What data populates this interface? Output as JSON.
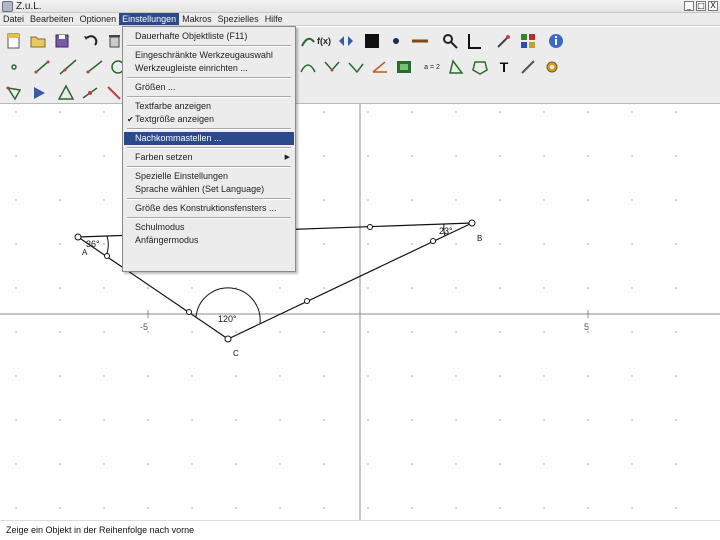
{
  "window": {
    "title": "Z.u.L.",
    "controls": [
      "_",
      "□",
      "X"
    ]
  },
  "menubar": [
    {
      "label": "Datei",
      "active": false
    },
    {
      "label": "Bearbeiten",
      "active": false
    },
    {
      "label": "Optionen",
      "active": false
    },
    {
      "label": "Einstellungen",
      "active": true
    },
    {
      "label": "Makros",
      "active": false
    },
    {
      "label": "Spezielles",
      "active": false
    },
    {
      "label": "Hilfe",
      "active": false
    }
  ],
  "toolbar": {
    "fx_label": "f(x)",
    "text_tool_label": "T",
    "ratio_label": "a = 2",
    "rows": [
      [
        "new-file-icon",
        "open-folder-icon",
        "save-disk-icon",
        "undo-icon",
        "delete-icon"
      ],
      [
        "point-icon",
        "segment-icon",
        "line-icon",
        "ray-icon",
        "circle-icon"
      ],
      [
        "polygon-icon",
        "triangle-icon",
        "reflect-icon",
        "move-icon",
        "tool-icon"
      ]
    ]
  },
  "dropdown": {
    "items": [
      {
        "label": "Dauerhafte Objektliste (F11)",
        "checked": false,
        "submenu": false,
        "highlighted": false
      },
      {
        "sep": true
      },
      {
        "label": "Eingeschränkte Werkzeugauswahl",
        "checked": false,
        "submenu": false,
        "highlighted": false
      },
      {
        "label": "Werkzeugleiste einrichten ...",
        "checked": false,
        "submenu": false,
        "highlighted": false
      },
      {
        "sep": true
      },
      {
        "label": "Größen ...",
        "checked": false,
        "submenu": false,
        "highlighted": false
      },
      {
        "sep": true
      },
      {
        "label": "Textfarbe anzeigen",
        "checked": false,
        "submenu": false,
        "highlighted": false
      },
      {
        "label": "Textgröße anzeigen",
        "checked": true,
        "submenu": false,
        "highlighted": false
      },
      {
        "sep": true
      },
      {
        "label": "Nachkommastellen ...",
        "checked": false,
        "submenu": false,
        "highlighted": true
      },
      {
        "sep": true
      },
      {
        "label": "Farben setzen",
        "checked": false,
        "submenu": true,
        "highlighted": false
      },
      {
        "sep": true
      },
      {
        "label": "Spezielle Einstellungen",
        "checked": false,
        "submenu": false,
        "highlighted": false
      },
      {
        "label": "Sprache wählen (Set Language)",
        "checked": false,
        "submenu": false,
        "highlighted": false
      },
      {
        "sep": true
      },
      {
        "label": "Größe des Konstruktionsfensters ...",
        "checked": false,
        "submenu": false,
        "highlighted": false
      },
      {
        "sep": true
      },
      {
        "label": "Schulmodus",
        "checked": false,
        "submenu": false,
        "highlighted": false
      },
      {
        "label": "Anfängermodus",
        "checked": false,
        "submenu": false,
        "highlighted": false
      }
    ]
  },
  "canvas": {
    "x_axis_ticks": [
      "-5",
      "5"
    ],
    "points": [
      {
        "label": "A"
      },
      {
        "label": "B"
      },
      {
        "label": "C"
      }
    ],
    "angles": [
      {
        "label": "36°"
      },
      {
        "label": "23°"
      },
      {
        "label": "120°"
      }
    ]
  },
  "status": {
    "text": "Zeige ein Objekt in der Reihenfolge nach vorne"
  },
  "colors": {
    "accent": "#2a4a8c",
    "menu_bg": "#ececec",
    "grid": "#b0b0b0"
  }
}
